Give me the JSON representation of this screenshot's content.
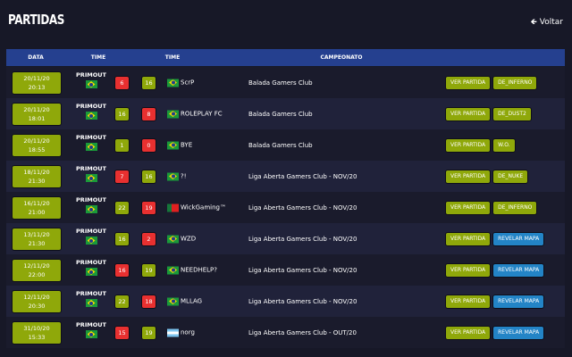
{
  "header": {
    "title": "PARTIDAS",
    "back_label": "Voltar"
  },
  "columns": {
    "date": "DATA",
    "team1": "TIME",
    "team2": "TIME",
    "championship": "CAMPEONATO"
  },
  "buttons": {
    "view": "VER PARTIDA",
    "reveal": "REVELAR MAPA"
  },
  "matches": [
    {
      "date": "20/11/20 20:13",
      "team1": "PRIMOUT",
      "score1": "6",
      "score2": "16",
      "result1": "lose",
      "result2": "win",
      "team2": "ScrP",
      "flag2": "br",
      "championship": "Balada Gamers Club",
      "map": "DE_INFERNO"
    },
    {
      "date": "20/11/20 18:01",
      "team1": "PRIMOUT",
      "score1": "16",
      "score2": "8",
      "result1": "win",
      "result2": "lose",
      "team2": "ROLEPLAY FC",
      "flag2": "br",
      "championship": "Balada Gamers Club",
      "map": "DE_DUST2"
    },
    {
      "date": "20/11/20 18:55",
      "team1": "PRIMOUT",
      "score1": "1",
      "score2": "0",
      "result1": "win",
      "result2": "lose",
      "team2": "BYE",
      "flag2": "br",
      "championship": "Balada Gamers Club",
      "map": "W.O."
    },
    {
      "date": "18/11/20 21:30",
      "team1": "PRIMOUT",
      "score1": "7",
      "score2": "16",
      "result1": "lose",
      "result2": "win",
      "team2": "?!",
      "flag2": "br",
      "championship": "Liga Aberta Gamers Club - NOV/20",
      "map": "DE_NUKE"
    },
    {
      "date": "16/11/20 21:00",
      "team1": "PRIMOUT",
      "score1": "22",
      "score2": "19",
      "result1": "win",
      "result2": "lose",
      "team2": "WickGaming™",
      "flag2": "pt",
      "championship": "Liga Aberta Gamers Club - NOV/20",
      "map": "DE_INFERNO"
    },
    {
      "date": "13/11/20 21:30",
      "team1": "PRIMOUT",
      "score1": "16",
      "score2": "2",
      "result1": "win",
      "result2": "lose",
      "team2": "WZD",
      "flag2": "br",
      "championship": "Liga Aberta Gamers Club - NOV/20",
      "map": null
    },
    {
      "date": "12/11/20 22:00",
      "team1": "PRIMOUT",
      "score1": "16",
      "score2": "19",
      "result1": "lose",
      "result2": "win",
      "team2": "NEEDHELP?",
      "flag2": "br",
      "championship": "Liga Aberta Gamers Club - NOV/20",
      "map": null
    },
    {
      "date": "12/11/20 20:30",
      "team1": "PRIMOUT",
      "score1": "22",
      "score2": "18",
      "result1": "win",
      "result2": "lose",
      "team2": "MLLAG",
      "flag2": "br",
      "championship": "Liga Aberta Gamers Club - NOV/20",
      "map": null
    },
    {
      "date": "31/10/20 15:33",
      "team1": "PRIMOUT",
      "score1": "15",
      "score2": "19",
      "result1": "lose",
      "result2": "win",
      "team2": "norg",
      "flag2": "ar",
      "championship": "Liga Aberta Gamers Club - OUT/20",
      "map": null
    }
  ]
}
